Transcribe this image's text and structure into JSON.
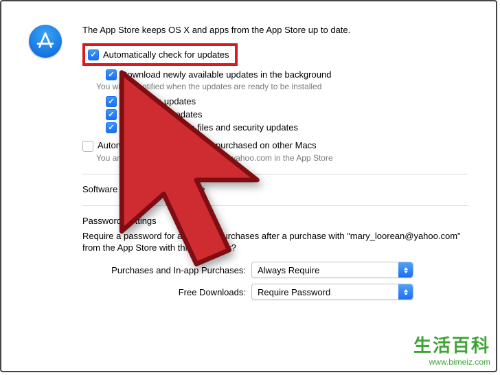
{
  "intro": "The App Store keeps OS X and apps from the App Store up to date.",
  "options": {
    "auto_check": {
      "label": "Automatically check for updates",
      "checked": true
    },
    "download_bg": {
      "label": "Download newly available updates in the background",
      "sub": "You will be notified when the updates are ready to be installed",
      "checked": true
    },
    "install_app": {
      "label": "Install app updates",
      "checked": true
    },
    "install_osx": {
      "label": "Install OS X updates",
      "checked": true
    },
    "install_sysdata": {
      "label": "Install system data files and security updates",
      "checked": true
    },
    "auto_download_other": {
      "label": "Automatically download apps purchased on other Macs",
      "sub": "You are signed in as mary_loorean@yahoo.com in the App Store",
      "checked": false
    }
  },
  "updates_line": "Software updates are available",
  "password_settings": {
    "title": "Password Settings",
    "desc": "Require a password for additional purchases after a purchase with \"mary_loorean@yahoo.com\" from the App Store with this computer?",
    "purchases_label": "Purchases and In-app Purchases:",
    "purchases_value": "Always Require",
    "free_label": "Free Downloads:",
    "free_value": "Require Password"
  },
  "watermark": {
    "line1": "生活百科",
    "line2": "www.bimeiz.com"
  },
  "icons": {
    "app_store": "app-store-icon"
  }
}
